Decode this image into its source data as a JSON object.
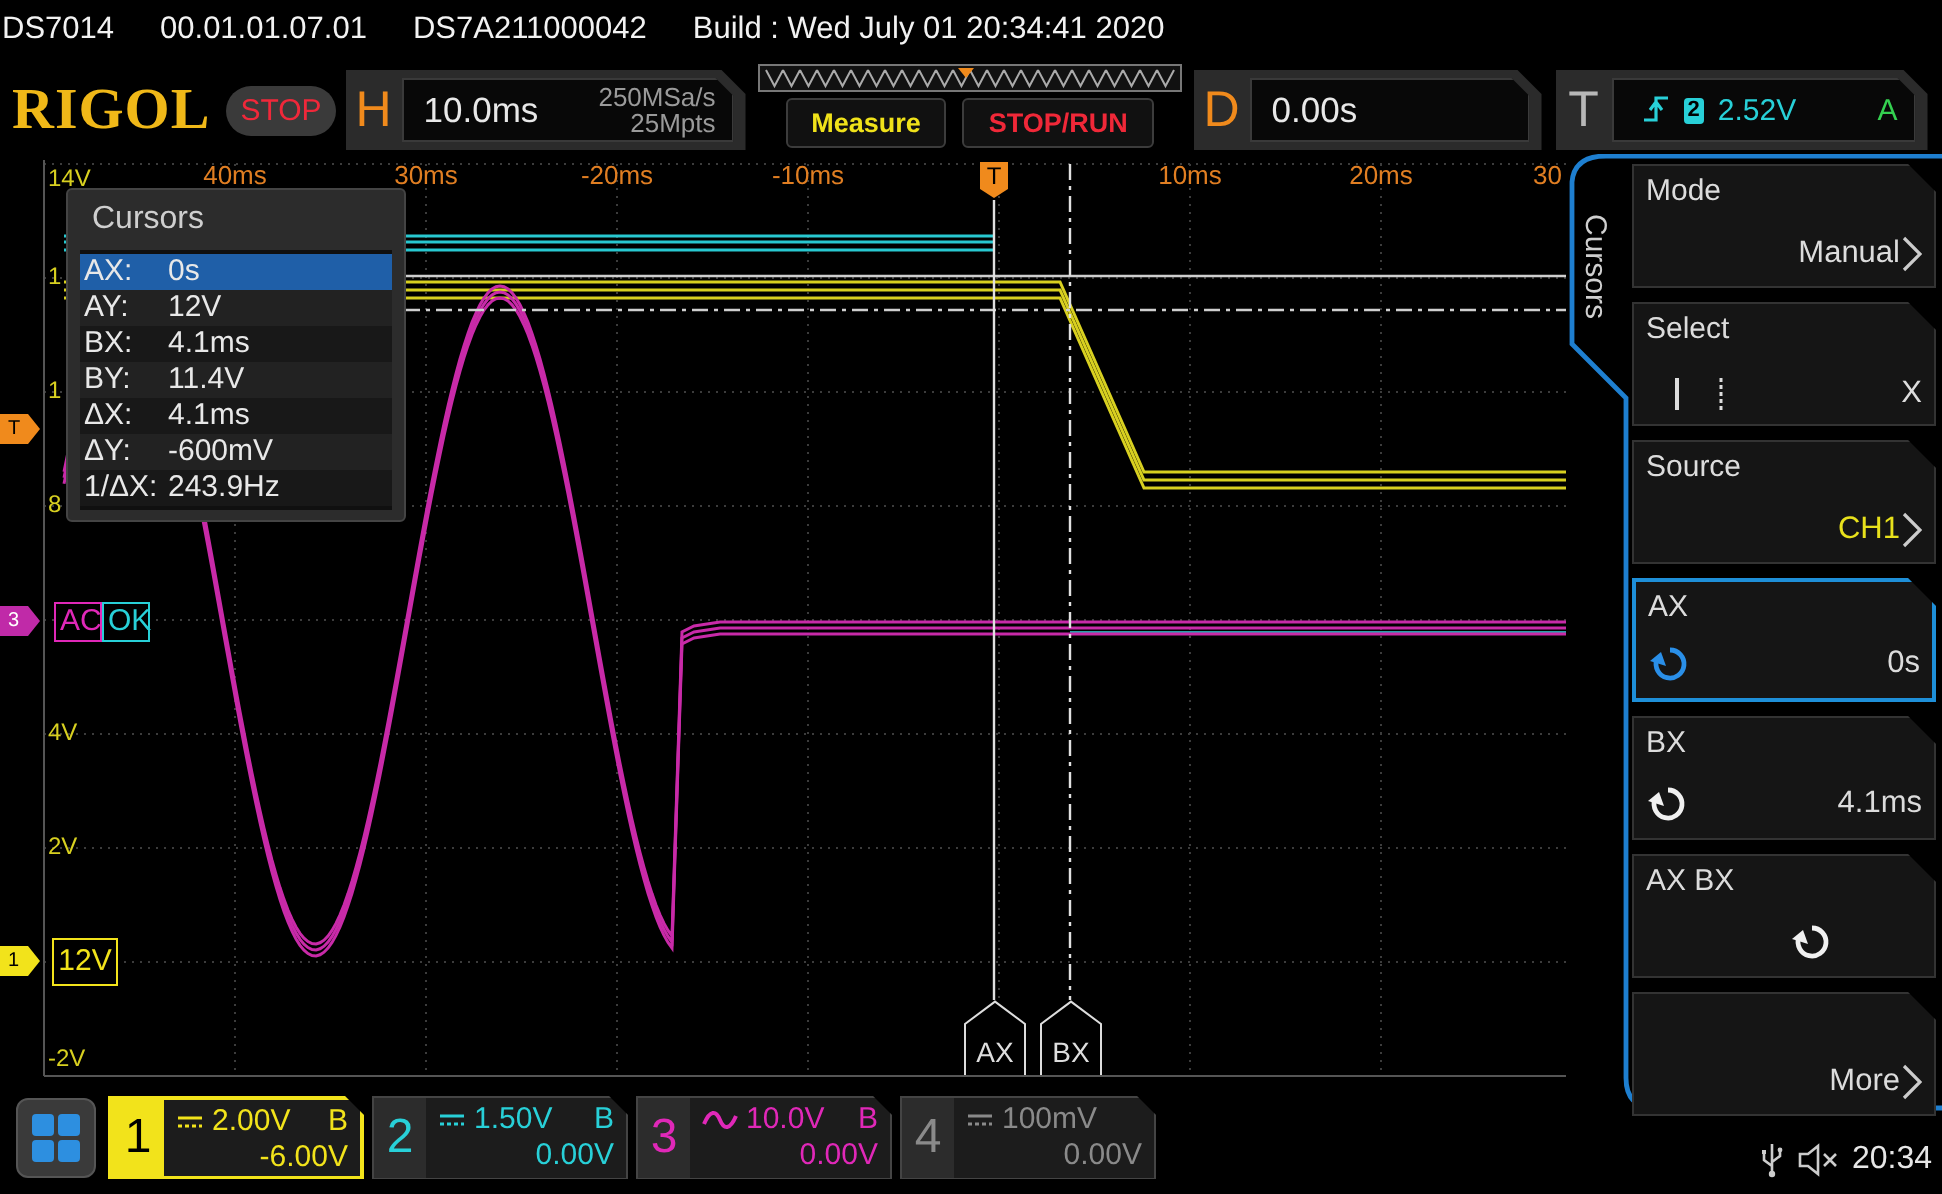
{
  "info_bar": [
    "DS7014",
    "00.01.01.07.01",
    "DS7A211000042",
    "Build : Wed July 01 20:34:41 2020"
  ],
  "header": {
    "logo": "RIGOL",
    "run_state": "STOP",
    "running": false,
    "horizontal": {
      "letter": "H",
      "timebase": "10.0ms",
      "sample_rate": "250MSa/s",
      "memory_depth": "25Mpts"
    },
    "buttons": [
      {
        "label": "Measure",
        "kind": "measure"
      },
      {
        "label": "STOP/RUN",
        "kind": "runstop"
      }
    ],
    "delay": {
      "letter": "D",
      "value": "0.00s"
    },
    "trigger": {
      "letter": "T",
      "source": "2",
      "level": "2.52V",
      "sweep": "A"
    }
  },
  "graticule": {
    "time_labels": [
      "40ms",
      "30ms",
      "-20ms",
      "-10ms",
      "10ms",
      "20ms",
      "30"
    ],
    "volt_labels": [
      "14V",
      "1",
      "1",
      "8",
      "4V",
      "2V",
      "-2V"
    ],
    "trigger_position_marker": "T",
    "trigger_level_marker": "T",
    "ch3_marker": "3",
    "ch3_tags": [
      "AC",
      "OK"
    ],
    "ch1_marker": "1",
    "ch1_tag": "12V",
    "cursor_tags": [
      "AX",
      "BX"
    ]
  },
  "cursor_readout": {
    "title": "Cursors",
    "rows": [
      {
        "label": "AX:",
        "value": "0s",
        "selected": true
      },
      {
        "label": "AY:",
        "value": "12V",
        "selected": false
      },
      {
        "label": "BX:",
        "value": "4.1ms",
        "selected": false
      },
      {
        "label": "BY:",
        "value": "11.4V",
        "selected": false
      },
      {
        "label": "ΔX:",
        "value": "4.1ms",
        "selected": false
      },
      {
        "label": "ΔY:",
        "value": "-600mV",
        "selected": false
      },
      {
        "label": "1/ΔX:",
        "value": "243.9Hz",
        "selected": false
      }
    ]
  },
  "menu": {
    "tab": "Cursors",
    "items": [
      {
        "kind": "submenu",
        "label": "Mode",
        "value": "Manual",
        "selected": false
      },
      {
        "kind": "select",
        "label": "Select",
        "value": "X",
        "selected": false
      },
      {
        "kind": "submenu",
        "label": "Source",
        "value": "CH1",
        "color": "#e8e11c",
        "selected": false
      },
      {
        "kind": "knob",
        "label": "AX",
        "value": "0s",
        "selected": true
      },
      {
        "kind": "knob",
        "label": "BX",
        "value": "4.1ms",
        "selected": false
      },
      {
        "kind": "knob",
        "label": "AX BX",
        "selected": false
      },
      {
        "kind": "submenu",
        "value": "More",
        "selected": false
      }
    ]
  },
  "channels": [
    {
      "number": "1",
      "kind": "dc",
      "scale": "2.00V",
      "bandwidth": "B",
      "offset": "-6.00V",
      "color": "#f2e31b",
      "selected": true,
      "on": true
    },
    {
      "number": "2",
      "kind": "dc",
      "scale": "1.50V",
      "bandwidth": "B",
      "offset": "0.00V",
      "color": "#28d0d8",
      "selected": false,
      "on": true
    },
    {
      "number": "3",
      "kind": "ac",
      "scale": "10.0V",
      "bandwidth": "B",
      "offset": "0.00V",
      "color": "#e028b8",
      "selected": false,
      "on": true
    },
    {
      "number": "4",
      "kind": "dc",
      "scale": "100mV",
      "offset": "0.00V",
      "selected": false,
      "on": false
    }
  ],
  "status": {
    "usb": true,
    "muted": true,
    "time": "20:34"
  }
}
